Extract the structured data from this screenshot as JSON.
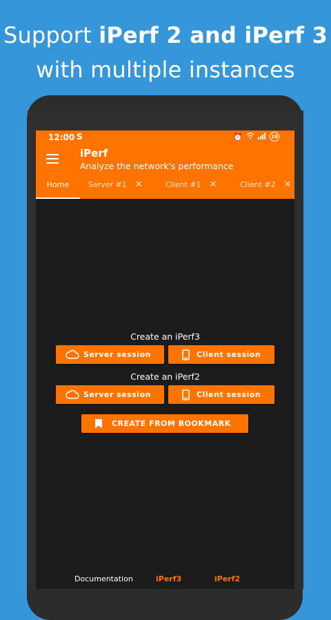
{
  "promo": {
    "line1_prefix": "Support ",
    "line1_bold": "iPerf 2 and iPerf 3",
    "line2": "with multiple instances"
  },
  "status_bar": {
    "time": "12:00",
    "notification_badge": "16"
  },
  "app_bar": {
    "title": "iPerf",
    "subtitle": "Analyze the network's performance"
  },
  "tabs": [
    {
      "label": "Home",
      "closable": false,
      "active": true
    },
    {
      "label": "Server #1",
      "closable": true,
      "active": false
    },
    {
      "label": "Client #1",
      "closable": true,
      "active": false
    },
    {
      "label": "Client #2",
      "closable": true,
      "active": false
    }
  ],
  "iperf3_section": {
    "label": "Create an iPerf3",
    "server_button": "Server session",
    "client_button": "Client session"
  },
  "iperf2_section": {
    "label": "Create an iPerf2",
    "server_button": "Server session",
    "client_button": "Client session"
  },
  "bookmark_button": "CREATE FROM BOOKMARK",
  "footer": {
    "documentation": "Documentation",
    "iperf3": "iPerf3",
    "iperf2": "iPerf2"
  },
  "tab_close_glyph": "✕",
  "colors": {
    "background": "#3596d9",
    "accent": "#ff7300",
    "screen": "#1c1c1c"
  }
}
